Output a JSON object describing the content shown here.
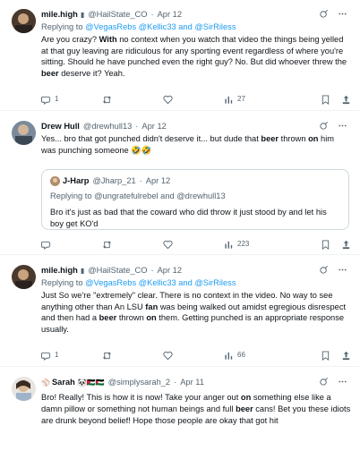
{
  "tweets": [
    {
      "name": "mile.high",
      "handle": "@HailState_CO",
      "dot": "·",
      "date": "Apr 12",
      "reply_prefix": "Replying to",
      "reply_targets": "@VegasRebs @Kellic33 and @SirRiless",
      "text_parts": [
        "Are you crazy? ",
        "With",
        " no context when you watch that video the things being yelled at that guy leaving are ridiculous for any sporting event regardless of where you're sitting. Should he have punched even the right guy? No. But did whoever threw the ",
        "beer",
        " deserve it? Yeah."
      ],
      "replies": "1",
      "retweets": "",
      "likes": "",
      "views": "27"
    },
    {
      "name": "Drew Hull",
      "handle": "@drewhull13",
      "dot": "·",
      "date": "Apr 12",
      "text_parts": [
        "Yes... bro that got punched didn't deserve it... but dude that ",
        "beer",
        " thrown ",
        "on",
        " him was punching someone 🤣🤣"
      ],
      "quote": {
        "name": "J-Harp",
        "handle": "@Jharp_21",
        "dot": "·",
        "date": "Apr 12",
        "reply_prefix": "Replying to",
        "reply_targets": "@ungratefulrebel and @drewhull13",
        "text": "Bro it's just as bad that the coward who did throw it just stood by and let his boy get KO'd"
      },
      "replies": "",
      "retweets": "",
      "likes": "",
      "views": "223"
    },
    {
      "name": "mile.high",
      "handle": "@HailState_CO",
      "dot": "·",
      "date": "Apr 12",
      "reply_prefix": "Replying to",
      "reply_targets": "@VegasRebs @Kellic33 and @SirRiless",
      "text_parts": [
        "Just So we're \"extremely\" clear. There is no context in the video. No way to see anything other than An LSU ",
        "fan",
        " was being walked out amidst egregious disrespect and then had a ",
        "beer",
        " thrown ",
        "on",
        " them. Getting punched is an appropriate response usually."
      ],
      "replies": "1",
      "retweets": "",
      "likes": "",
      "views": "66"
    },
    {
      "name": "Sarah",
      "emojis": "🐼🇯🇴🇵🇸",
      "handle": "@simplysarah_2",
      "dot": "·",
      "date": "Apr 11",
      "text_parts": [
        "Bro! Really! This is how it is now! Take your anger out ",
        "on",
        " something else like a damn pillow or something not human beings and full ",
        "beer",
        " cans! Bet you these idiots are drunk beyond belief! Hope those people are okay that got hit"
      ]
    }
  ],
  "icons": {
    "reply": "reply-icon",
    "retweet": "retweet-icon",
    "like": "heart-icon",
    "views": "views-icon",
    "bookmark": "bookmark-icon",
    "share": "share-icon",
    "grok": "grok-icon",
    "more": "more-icon"
  },
  "colors": {
    "link": "#1d9bf0",
    "secondary": "#536471",
    "divider": "#eff3f4"
  }
}
